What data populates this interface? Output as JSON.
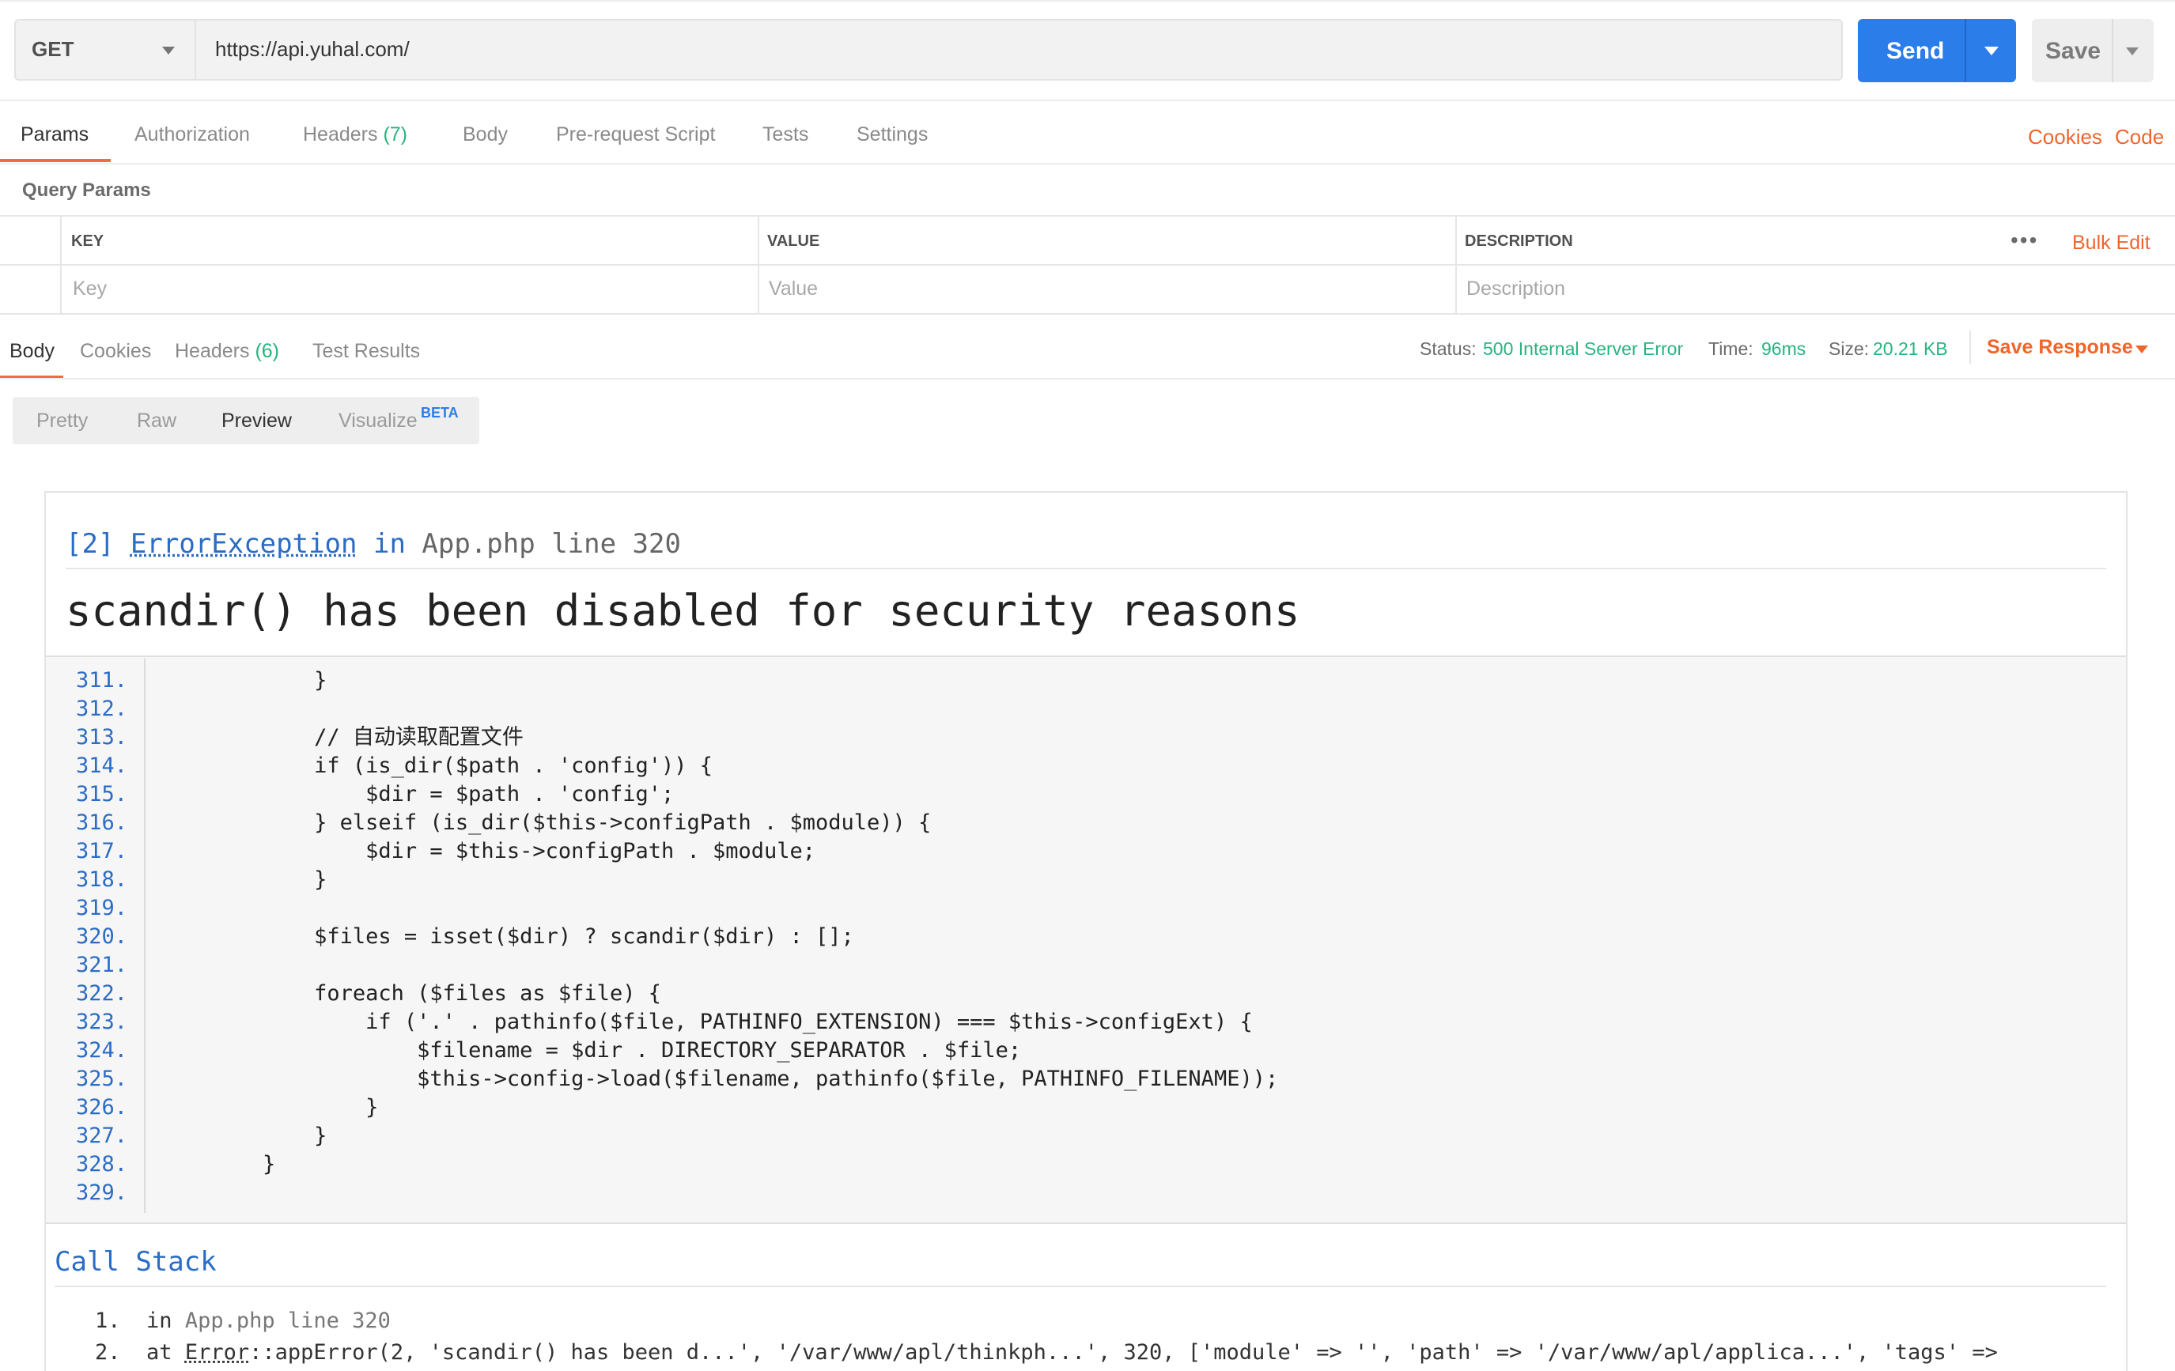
{
  "request": {
    "method": "GET",
    "url": "https://api.yuhal.com/",
    "send_label": "Send",
    "save_label": "Save"
  },
  "request_tabs": [
    {
      "label": "Params",
      "count": ""
    },
    {
      "label": "Authorization",
      "count": ""
    },
    {
      "label": "Headers",
      "count": "(7)"
    },
    {
      "label": "Body",
      "count": ""
    },
    {
      "label": "Pre-request Script",
      "count": ""
    },
    {
      "label": "Tests",
      "count": ""
    },
    {
      "label": "Settings",
      "count": ""
    }
  ],
  "request_links": {
    "cookies": "Cookies",
    "code": "Code"
  },
  "query_params": {
    "title": "Query Params",
    "headers": {
      "key": "KEY",
      "value": "VALUE",
      "description": "DESCRIPTION"
    },
    "placeholders": {
      "key": "Key",
      "value": "Value",
      "description": "Description"
    },
    "more": "•••",
    "bulk_edit": "Bulk Edit"
  },
  "response_tabs": [
    {
      "label": "Body",
      "count": ""
    },
    {
      "label": "Cookies",
      "count": ""
    },
    {
      "label": "Headers",
      "count": "(6)"
    },
    {
      "label": "Test Results",
      "count": ""
    }
  ],
  "response_status": {
    "status_label": "Status:",
    "status_value": "500 Internal Server Error",
    "time_label": "Time:",
    "time_value": "96ms",
    "size_label": "Size:",
    "size_value": "20.21 KB",
    "save_response": "Save Response"
  },
  "view_modes": [
    "Pretty",
    "Raw",
    "Preview",
    "Visualize"
  ],
  "beta_badge": "BETA",
  "error": {
    "prefix": "[2]",
    "exception": "ErrorException",
    "in_word": "in",
    "file": "App.php",
    "line_word": "line 320",
    "message": "scandir() has been disabled for security reasons"
  },
  "code_lines": [
    {
      "n": "311.",
      "t": "            }"
    },
    {
      "n": "312.",
      "t": ""
    },
    {
      "n": "313.",
      "t": "            // 自动读取配置文件"
    },
    {
      "n": "314.",
      "t": "            if (is_dir($path . 'config')) {"
    },
    {
      "n": "315.",
      "t": "                $dir = $path . 'config';"
    },
    {
      "n": "316.",
      "t": "            } elseif (is_dir($this->configPath . $module)) {"
    },
    {
      "n": "317.",
      "t": "                $dir = $this->configPath . $module;"
    },
    {
      "n": "318.",
      "t": "            }"
    },
    {
      "n": "319.",
      "t": ""
    },
    {
      "n": "320.",
      "t": "            $files = isset($dir) ? scandir($dir) : [];"
    },
    {
      "n": "321.",
      "t": ""
    },
    {
      "n": "322.",
      "t": "            foreach ($files as $file) {"
    },
    {
      "n": "323.",
      "t": "                if ('.' . pathinfo($file, PATHINFO_EXTENSION) === $this->configExt) {"
    },
    {
      "n": "324.",
      "t": "                    $filename = $dir . DIRECTORY_SEPARATOR . $file;"
    },
    {
      "n": "325.",
      "t": "                    $this->config->load($filename, pathinfo($file, PATHINFO_FILENAME));"
    },
    {
      "n": "326.",
      "t": "                }"
    },
    {
      "n": "327.",
      "t": "            }"
    },
    {
      "n": "328.",
      "t": "        }"
    },
    {
      "n": "329.",
      "t": ""
    }
  ],
  "call_stack": {
    "title": "Call Stack",
    "item1": {
      "num": "1.",
      "prefix": "in ",
      "file": "App.php",
      "rest": " line 320"
    },
    "item2": {
      "num": "2.",
      "prefix": "at ",
      "cls": "Error",
      "rest": "::appError(2, 'scandir() has been d...', '/var/www/apl/thinkph...', 320, ['module' => '', 'path' => '/var/www/apl/applica...', 'tags' =>"
    }
  }
}
